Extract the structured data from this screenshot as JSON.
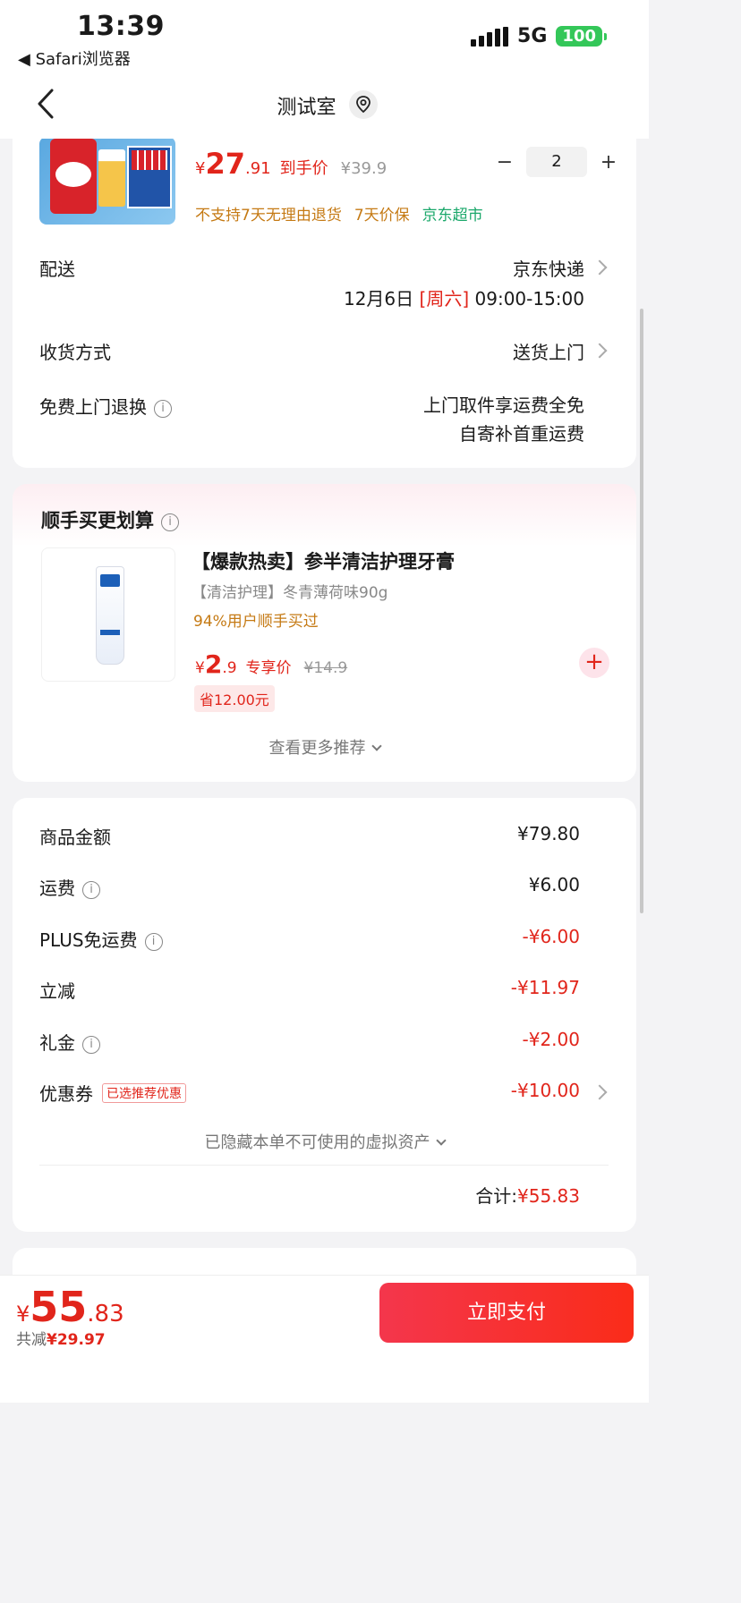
{
  "status": {
    "time": "13:39",
    "back_app": "◀ Safari浏览器",
    "network": "5G",
    "battery": "100"
  },
  "nav": {
    "title": "测试室"
  },
  "product": {
    "currency": "¥",
    "price_int": "27",
    "price_dec": ".91",
    "price_tag": "到手价",
    "orig_price": "¥39.9",
    "quantity": "2",
    "minus": "−",
    "plus": "+",
    "services": [
      "不支持7天无理由退货",
      "7天价保",
      "京东超市"
    ]
  },
  "delivery": {
    "label": "配送",
    "method": "京东快递",
    "date": "12月6日",
    "weekday": "[周六]",
    "time_window": "09:00-15:00"
  },
  "receive": {
    "label": "收货方式",
    "value": "送货上门"
  },
  "free_return": {
    "label": "免费上门退换",
    "line1": "上门取件享运费全免",
    "line2": "自寄补首重运费"
  },
  "upsell": {
    "title": "顺手买更划算",
    "name": "【爆款热卖】参半清洁护理牙膏",
    "spec": "【清洁护理】冬青薄荷味90g",
    "buy_tip": "94%用户顺手买过",
    "currency": "¥",
    "price_int": "2",
    "price_dec": ".9",
    "price_tag": "专享价",
    "orig_price": "¥14.9",
    "save": "省12.00元",
    "more": "查看更多推荐"
  },
  "summary": {
    "goods_label": "商品金额",
    "goods_value": "¥79.80",
    "freight_label": "运费",
    "freight_value": "¥6.00",
    "plus_label": "PLUS免运费",
    "plus_value": "-¥6.00",
    "discount_label": "立减",
    "discount_value": "-¥11.97",
    "gift_label": "礼金",
    "gift_value": "-¥2.00",
    "coupon_label": "优惠券",
    "coupon_badge": "已选推荐优惠",
    "coupon_value": "-¥10.00",
    "hidden_tip": "已隐藏本单不可使用的虚拟资产",
    "total_label": "合计:",
    "total_value": "¥55.83"
  },
  "footer": {
    "currency": "¥",
    "total_int": "55",
    "total_dec": ".83",
    "saved_label": "共减",
    "saved_value": "¥29.97",
    "pay_label": "立即支付"
  },
  "colors": {
    "accent": "#e1251b",
    "services_orange": "#c57a14",
    "services_green": "#1ba86b",
    "battery": "#34c759"
  }
}
